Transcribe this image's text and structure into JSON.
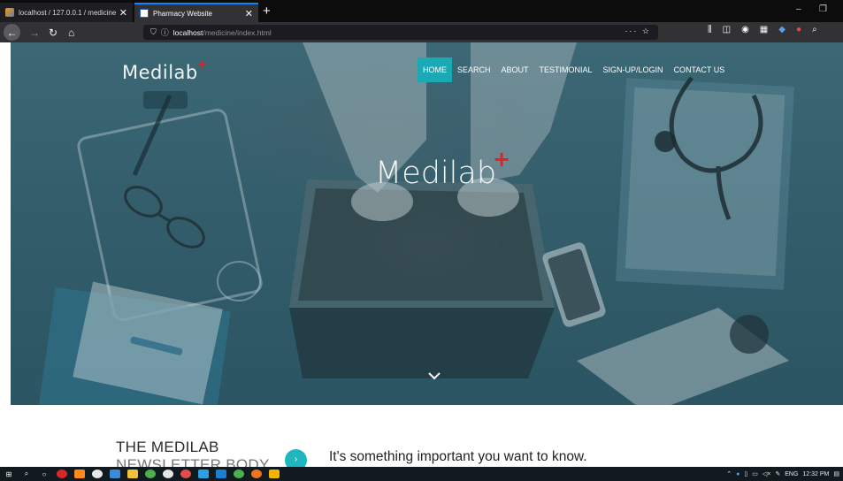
{
  "browser": {
    "tabs": [
      {
        "title": "localhost / 127.0.0.1 / medicine",
        "active": false
      },
      {
        "title": "Pharmacy Website",
        "active": true
      }
    ],
    "new_tab": "+",
    "url_host": "localhost",
    "url_path": "/medicine/index.html",
    "url_right": "··· ☆",
    "window_controls": {
      "minimize": "–",
      "restore": "❐"
    }
  },
  "site": {
    "logo": "Medilab",
    "logo_mark": "+",
    "nav": [
      "HOME",
      "SEARCH",
      "ABOUT",
      "TESTIMONIAL",
      "SIGN-UP/LOGIN",
      "CONTACT US"
    ],
    "active_nav": "HOME",
    "hero_title": "Medilab",
    "hero_mark": "+",
    "scroll_icon": "⌄",
    "section_title_line1": "THE MEDILAB",
    "section_title_line2": "NEWSLETTER BODY",
    "section_button": "›",
    "section_text": "It's something important you want to know."
  },
  "taskbar": {
    "tray_text": "ENG",
    "time": "12:32 PM"
  },
  "colors": {
    "accent": "#1aa9b5",
    "hero_tint": "#335d6b",
    "plus_red": "#e31e24",
    "active_tab_line": "#0a84ff"
  }
}
